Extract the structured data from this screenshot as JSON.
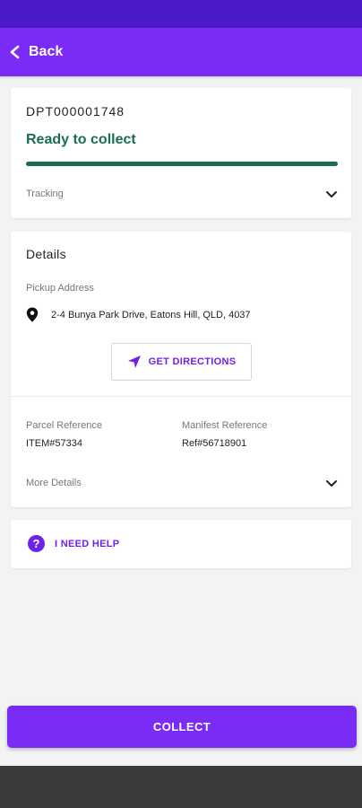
{
  "header": {
    "back_label": "Back"
  },
  "parcel": {
    "consignment_id": "DPT000001748",
    "status": "Ready to collect",
    "progress": 1.0,
    "tracking_label": "Tracking"
  },
  "details": {
    "title": "Details",
    "pickup_label": "Pickup Address",
    "address": "2-4 Bunya Park Drive, Eatons Hill, QLD, 4037",
    "directions_label": "GET DIRECTIONS",
    "parcel_ref_label": "Parcel Reference",
    "parcel_ref_value": "ITEM#57334",
    "manifest_ref_label": "Manifest Reference",
    "manifest_ref_value": "Ref#56718901",
    "more_details_label": "More Details"
  },
  "help": {
    "label": "I NEED HELP",
    "icon_glyph": "?"
  },
  "actions": {
    "collect_label": "COLLECT"
  },
  "colors": {
    "primary": "#7a2bf5",
    "status_bar": "#4a19c8",
    "success": "#1a6d4f",
    "accent_text": "#6c23e6"
  },
  "icons": [
    "chevron-left-icon",
    "chevron-down-icon",
    "location-pin-icon",
    "navigation-arrow-icon",
    "help-circle-icon"
  ]
}
